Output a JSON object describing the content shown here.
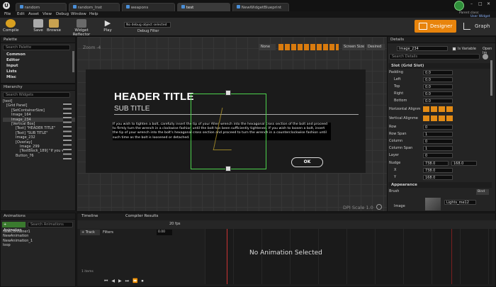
{
  "tabs": [
    "random",
    "random_Inst",
    "weapons",
    "test",
    "NewWidgetBlueprint"
  ],
  "menu": [
    "File",
    "Edit",
    "Asset",
    "View",
    "Debug",
    "Window",
    "Help"
  ],
  "parent_class_label": "Parent class:",
  "parent_class_value": "User Widget",
  "toolbar": {
    "compile": "Compile",
    "save": "Save",
    "browse": "Browse",
    "widget_reflector": "Widget Reflector",
    "play": "Play",
    "debug_select": "No debug object selected",
    "debug_filter": "Debug Filter",
    "designer": "Designer",
    "graph": "Graph"
  },
  "palette": {
    "title": "Palette",
    "search": "Search Palette",
    "categories": [
      "Common",
      "Editor",
      "Input",
      "Lists",
      "Misc"
    ]
  },
  "hierarchy": {
    "title": "Hierarchy",
    "search": "Search Widgets",
    "rows": [
      "[test]",
      "[Grid Panel]",
      "[SetContainerSize]",
      "Image_164",
      "Image_234",
      "[Vertical Box]",
      "[Text] \"HEADER TITLE\"",
      "[Text] \"SUB TITLE\"",
      "Image_232",
      "[Overlay]",
      "Image_299",
      "[TextBlock_189] \"If you wis",
      "Button_76"
    ]
  },
  "canvas": {
    "zoom": "Zoom -4",
    "none_btn": "None",
    "screen_size": "Screen Size",
    "desired": "Desired",
    "dpi": "DPI Scale 1.0",
    "header": "HEADER TITLE",
    "sub": "SUB TITLE",
    "body": "If you wish to tighten a bolt, carefully insert the tip of your Allen wrench into the hexagonal cross section of the bolt and proceed to firmly turn the wrench in a clockwise fashion until the bolt has been sufficiently tightened. If you wish to loosen a bolt, insert the tip of your wrench into the bolt's hexagonal cross section and proceed to turn the wrench in a counterclockwise fashion until such time as the bolt is loosened or detached.",
    "ok": "OK"
  },
  "details": {
    "title": "Details",
    "name": "Image_234",
    "is_variable": "Is Variable",
    "open_in": "Open Im",
    "search": "Search Details",
    "section_slot": "Slot (Grid Slot)",
    "padding": "Padding",
    "left": "Left",
    "top": "Top",
    "right": "Right",
    "bottom": "Bottom",
    "padding_values": [
      "0.0",
      "0.0",
      "0.0",
      "0.0",
      "0.0"
    ],
    "h_align": "Horizontal Alignm",
    "v_align": "Vertical Alignme",
    "row": "Row",
    "row_span": "Row Span",
    "column": "Column",
    "column_span": "Column Span",
    "layer": "Layer",
    "grid_values": [
      "0",
      "1",
      "0",
      "1",
      "0"
    ],
    "nudge": "Nudge",
    "nudge_values": [
      "738.0",
      "168.0"
    ],
    "x": "X",
    "y": "Y",
    "x_value": "738.0",
    "y_value": "168.0",
    "section_appearance": "Appearance",
    "brush": "Brush",
    "bind": "Bind",
    "image": "Image",
    "image_value": "Lights_me12"
  },
  "animations": {
    "title": "Animations",
    "search": "Search Animations",
    "add": "+ Animation",
    "items": [
      "fadeContainer1",
      "NewAnimation",
      "NewAnimation_1",
      "loop"
    ]
  },
  "timeline": {
    "tab_timeline": "Timeline",
    "tab_compiler": "Compiler Results",
    "track": "+ Track",
    "filters": "Filters",
    "fps": "20 fps",
    "no_anim": "No Animation Selected",
    "items_count": "1 items",
    "time_value": "0.00"
  }
}
